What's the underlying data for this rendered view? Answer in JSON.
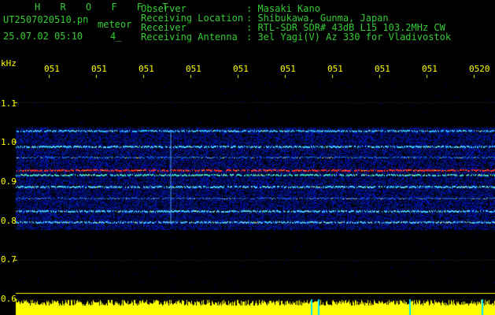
{
  "header": {
    "title": "H R O F F T",
    "filename": "UT2507020510.pn",
    "mode": "meteor",
    "datetime": "25.07.02 05:10",
    "count": "4_"
  },
  "info": {
    "rows": [
      {
        "label": "Observer",
        "value": ": Masaki Kano"
      },
      {
        "label": "Receiving Location",
        "value": ": Shibukawa, Gunma, Japan"
      },
      {
        "label": "Receiver",
        "value": ": RTL-SDR SDR# 43dB L15 103.2MHz CW"
      },
      {
        "label": "Receiving Antenna",
        "value": ": 3el Yagi(V) Az 330 for Vladivostok"
      }
    ]
  },
  "axis": {
    "unit": "kHz",
    "x_ticks": [
      "051",
      "051",
      "051",
      "051",
      "051",
      "051",
      "051",
      "051",
      "051",
      "0520"
    ],
    "y_ticks": [
      "1.1",
      "1.0",
      "0.9",
      "0.8",
      "0.7",
      "0.6"
    ]
  },
  "colors": {
    "label": "#33cc33",
    "axis": "#ffff00",
    "background": "#000000",
    "noise": "#0a1fa8",
    "signal": "#ff3322"
  }
}
